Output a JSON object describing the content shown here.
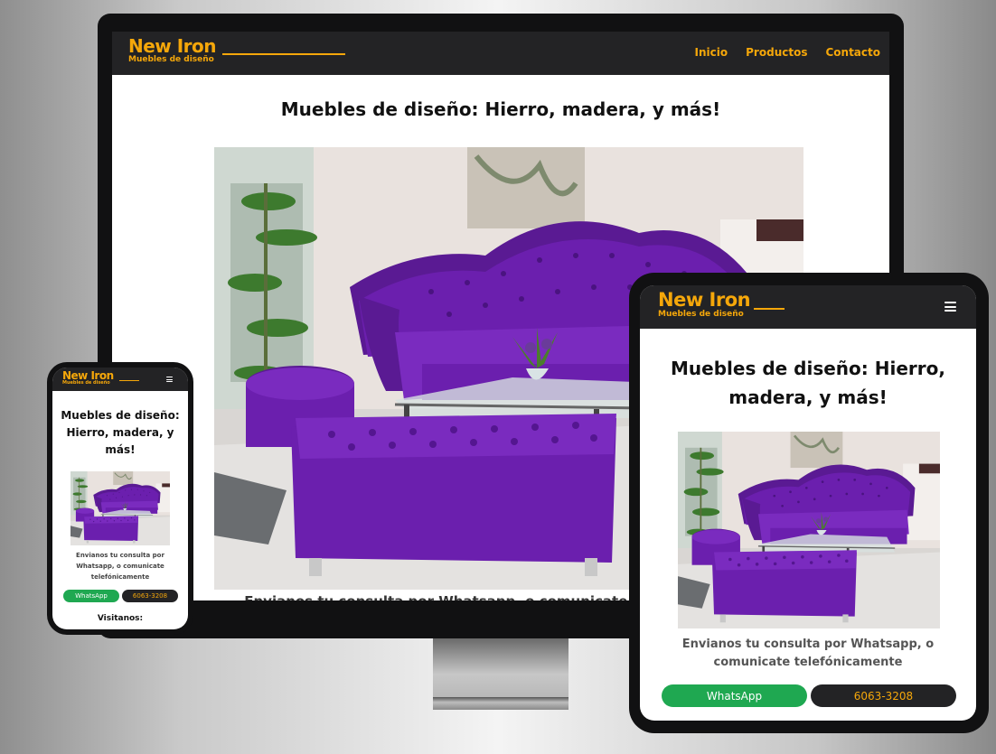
{
  "site": {
    "brand_name": "New Iron",
    "brand_tagline": "Muebles de diseño"
  },
  "nav": {
    "items": [
      "Inicio",
      "Productos",
      "Contacto"
    ]
  },
  "hero": {
    "heading": "Muebles de diseño: Hierro, madera, y más!",
    "contact_text": "Envianos tu consulta por Whatsapp, o comunicate telefónicamente"
  },
  "buttons": {
    "whatsapp_label": "WhatsApp",
    "phone_label": "6063-3208"
  },
  "footer": {
    "visits_label": "Visitanos:"
  },
  "icons": {
    "menu": "hamburger-menu-icon"
  },
  "colors": {
    "accent": "#f5a70a",
    "navbar": "#232325",
    "whatsapp": "#1fa851",
    "sofa": "#6b1fae",
    "device_frame": "#111112"
  }
}
